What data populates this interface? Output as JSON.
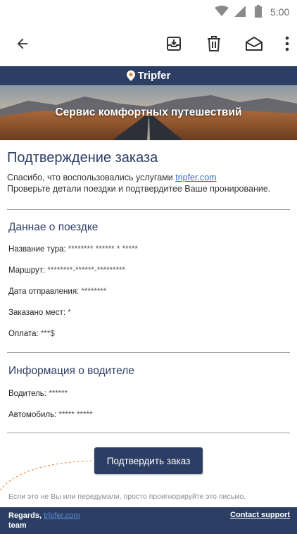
{
  "status_bar": {
    "time": "5:00"
  },
  "email": {
    "brand": "Tripfer",
    "hero_title": "Сервис комфортных путешествий",
    "heading": "Подтверждение заказа",
    "intro_line1": "Спасибо, что воспользовались услугами ",
    "intro_link": "tripfer.com",
    "intro_line2": "Проверьте детали поездки и подтвердитее Ваше пронирование.",
    "trip_section": {
      "title": "Даннае о поездке",
      "fields": [
        {
          "label": "Название тура: ",
          "value": "******** ****** * *****"
        },
        {
          "label": "Маршрут: ",
          "value": "********-******-*********"
        },
        {
          "label": "Дата отправления: ",
          "value": "********"
        },
        {
          "label": "Заказано мест: ",
          "value": "*"
        },
        {
          "label": "Оплата: ",
          "value": "***$"
        }
      ]
    },
    "driver_section": {
      "title": "Информация о водителе",
      "fields": [
        {
          "label": "Водитель: ",
          "value": "******"
        },
        {
          "label": "Автомобиль: ",
          "value": "***** *****"
        }
      ]
    },
    "confirm_button": "Подтвердить заказ",
    "disclaimer": "Если это не Вы или передумали, просто проигнорируйте это письмо.",
    "footer": {
      "regards": "Regards, ",
      "regards_link": "tripfer.com",
      "team": "team",
      "support": "Contact support"
    }
  },
  "colors": {
    "brand_navy": "#2c3e64",
    "link_blue": "#2f6fc6",
    "accent_orange": "#e8843a"
  }
}
